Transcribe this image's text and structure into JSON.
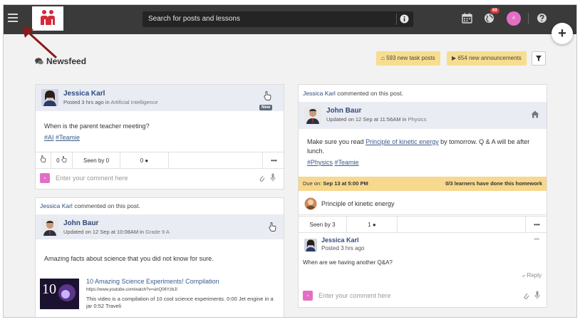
{
  "topbar": {
    "search_placeholder": "Search for posts and lessons",
    "notification_count": "69",
    "avatar_initial": "A"
  },
  "newsfeed": {
    "title": "Newsfeed",
    "task_posts": "593 new task posts",
    "announcements": "654 new announcements"
  },
  "left_col": {
    "post1": {
      "author": "Jessica Karl",
      "posted": "Posted 3 hrs ago",
      "in_word": "in",
      "group": "Artificial Intelligence",
      "new_label": "New",
      "text": "When is the parent teacher meeting?",
      "tags": [
        "#AI",
        "#Teamie"
      ],
      "likes": "0",
      "seen": "Seen by 0",
      "comments": "0",
      "more": "•••",
      "comment_placeholder": "Enter your comment here",
      "commenter_initial": "A"
    },
    "post2": {
      "commenter": "Jessica Karl",
      "commented_text": "commented on this post.",
      "author": "John Baur",
      "updated": "Updated on 12 Sep at 10:08AM",
      "in_word": "in",
      "group": "Grade 9 A",
      "text": "Amazing facts about science that you did not know for sure.",
      "video_title": "10 Amazing Science Experiments! Compilation",
      "video_url": "https://www.youtube.com/watch?v=sinQ06YzbJI",
      "video_desc": "This video is a compilation of 10 cool science experiments. 0:00 Jet engine in a jar 0:52 Traveli",
      "thumb_label": "10"
    }
  },
  "right_col": {
    "commenter": "Jessica Karl",
    "commented_text": "commented on this post.",
    "author": "John Baur",
    "updated": "Updated on 12 Sep at 11:56AM",
    "in_word": "in",
    "group": "Physics",
    "text_pre": "Make sure you read",
    "text_link": "Principle of kinetic energy",
    "text_post": "by tomorrow. Q & A will be after lunch.",
    "tags": [
      "#Physics",
      "#Teamie"
    ],
    "due_label": "Due on:",
    "due_date": "Sep 13 at 5:00 PM",
    "learners": "0/3 learners have done this homework",
    "homework_title": "Principle of kinetic energy",
    "seen": "Seen by 3",
    "comments": "1",
    "more": "•••",
    "comment": {
      "author": "Jessica Karl",
      "posted": "Posted 3 hrs ago",
      "text": "When are we having another Q&A?",
      "more": "•••",
      "reply": "Reply"
    },
    "comment_placeholder": "Enter your comment here",
    "commenter_initial": "A"
  },
  "colors": {
    "topbar": "#3a3a3a",
    "accent_yellow": "#f7dd8f",
    "name_blue": "#2f4b7c",
    "logo_red": "#d42b3a",
    "avatar_pink": "#e36fc5",
    "arrow_red": "#8b1a1a"
  }
}
